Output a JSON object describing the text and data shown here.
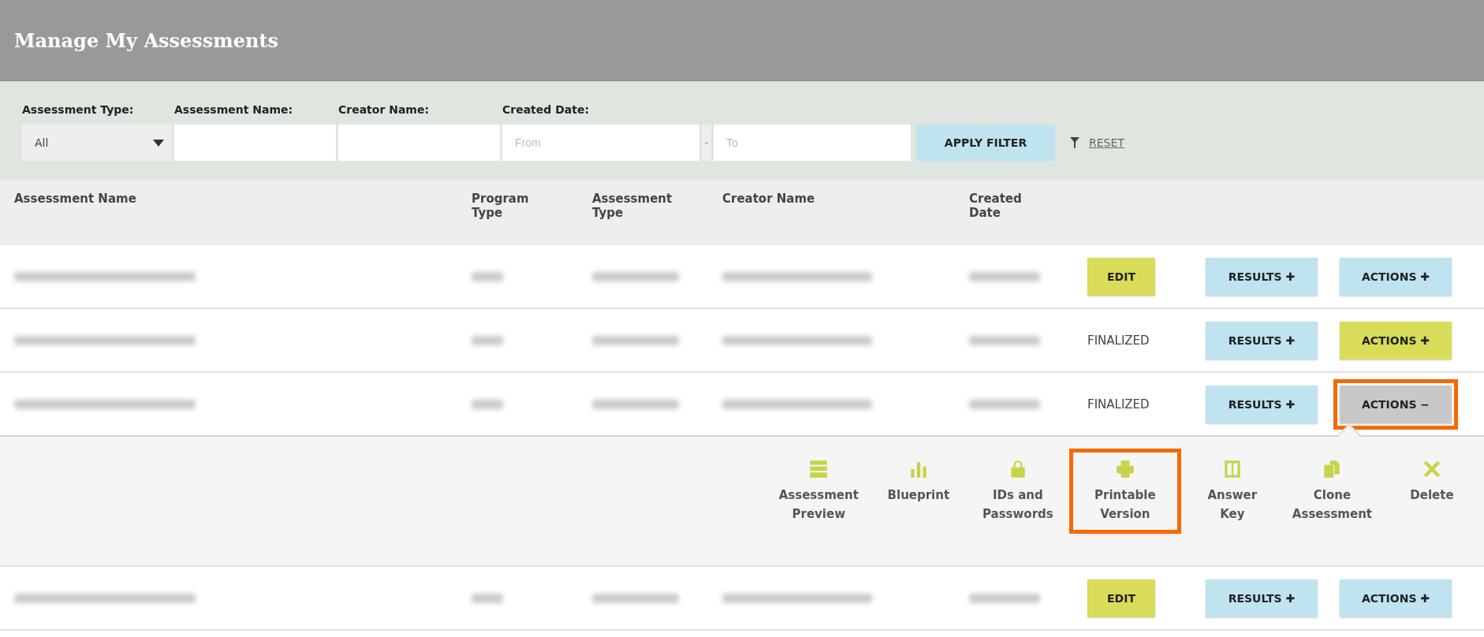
{
  "title": "Manage My Assessments",
  "filters": {
    "labels": [
      "Assessment Type:",
      "Assessment Name:",
      "Creator Name:",
      "Created Date:"
    ],
    "type_select": "All",
    "from_placeholder": "From",
    "separator": "-",
    "to_placeholder": "To",
    "apply": "APPLY FILTER",
    "reset": "RESET"
  },
  "columns": [
    "Assessment Name",
    "Program\nType",
    "Assessment\nType",
    "Creator Name",
    "Created\nDate"
  ],
  "rows": [
    {
      "status": {
        "kind": "button",
        "label": "EDIT"
      },
      "results": "RESULTS ✚",
      "actions": {
        "label": "ACTIONS ✚",
        "kind": "idle",
        "highlighted": false
      },
      "expanded": false
    },
    {
      "status": {
        "kind": "text",
        "label": "FINALIZED"
      },
      "results": "RESULTS ✚",
      "actions": {
        "label": "ACTIONS ✚",
        "kind": "hover",
        "highlighted": false
      },
      "expanded": false
    },
    {
      "status": {
        "kind": "text",
        "label": "FINALIZED"
      },
      "results": "RESULTS ✚",
      "actions": {
        "label": "ACTIONS −",
        "kind": "open",
        "highlighted": true
      },
      "expanded": true
    },
    {
      "status": {
        "kind": "button",
        "label": "EDIT"
      },
      "results": "RESULTS ✚",
      "actions": {
        "label": "ACTIONS ✚",
        "kind": "idle",
        "highlighted": false
      },
      "expanded": false
    }
  ],
  "action_menu": [
    {
      "kind": "preview",
      "label": "Assessment\nPreview",
      "highlighted": false
    },
    {
      "kind": "blueprint",
      "label": "Blueprint",
      "highlighted": false
    },
    {
      "kind": "lock",
      "label": "IDs and\nPasswords",
      "highlighted": false
    },
    {
      "kind": "print",
      "label": "Printable\nVersion",
      "highlighted": true
    },
    {
      "kind": "key",
      "label": "Answer\nKey",
      "highlighted": false
    },
    {
      "kind": "clone",
      "label": "Clone\nAssessment",
      "highlighted": false
    },
    {
      "kind": "delete",
      "label": "Delete",
      "highlighted": false
    }
  ]
}
